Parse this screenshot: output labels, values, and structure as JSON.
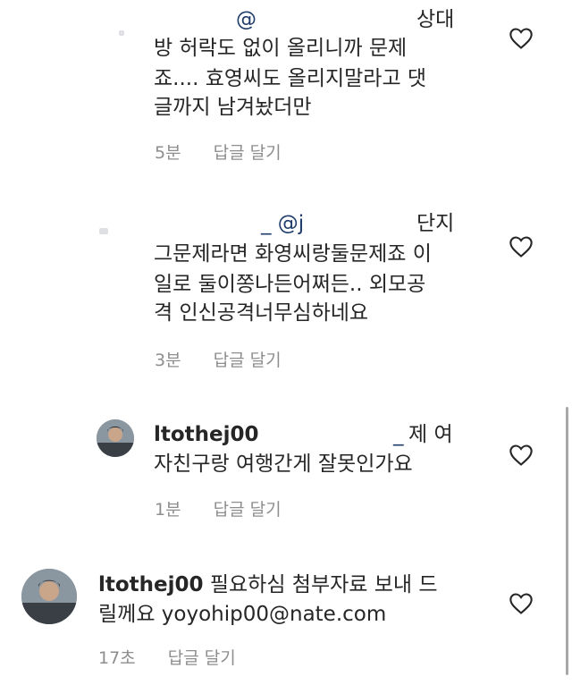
{
  "comments": [
    {
      "username": "",
      "mention": "@",
      "lines": [
        "상대",
        "방 허락도 없이 올리니까 문제",
        "죠.... 효영씨도 올리지말라고 댓",
        "글까지 남겨놨더만"
      ],
      "time": "5분",
      "reply": "답글 달기",
      "heart_icon": "heart-outline-icon"
    },
    {
      "username": "",
      "mention": "_ @j",
      "lines": [
        "단지",
        "그문제라면 화영씨랑둘문제죠 이",
        "일로 둘이쫑나든어쩌든.. 외모공",
        "격 인신공격너무심하네요"
      ],
      "time": "3분",
      "reply": "답글 달기",
      "heart_icon": "heart-outline-icon"
    },
    {
      "username": "ltothej00",
      "mention": "_",
      "lines": [
        "제 여",
        "자친구랑 여행간게 잘못인가요"
      ],
      "time": "1분",
      "reply": "답글 달기",
      "heart_icon": "heart-outline-icon"
    },
    {
      "username": "ltothej00",
      "lines": [
        "필요하심 첨부자료 보내 드",
        "릴께요 yoyohip00@nate.com"
      ],
      "time": "17초",
      "reply": "답글 달기",
      "heart_icon": "heart-outline-icon"
    }
  ]
}
